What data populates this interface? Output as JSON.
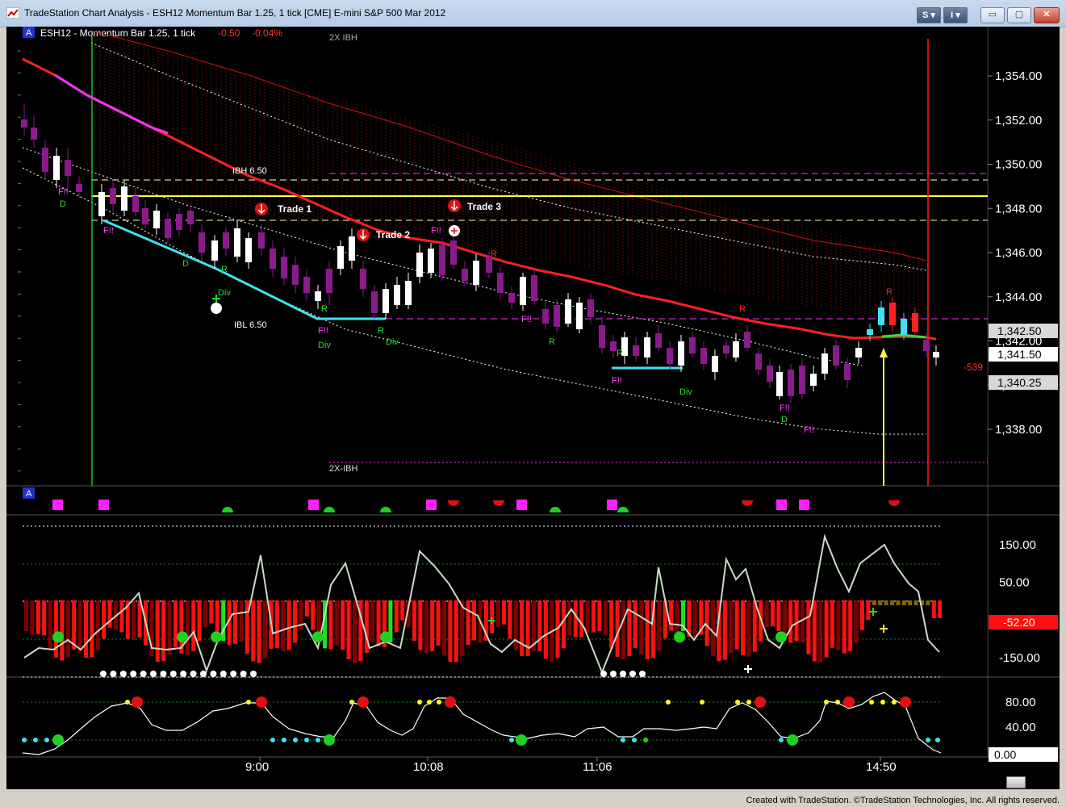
{
  "window": {
    "title": "TradeStation Chart Analysis - ESH12 Momentum Bar 1.25, 1 tick [CME] E-mini S&P 500 Mar 2012",
    "s_button": "S ▾",
    "i_button": "I ▾",
    "minimize": "▭",
    "maximize": "▢",
    "close": "✕"
  },
  "chart": {
    "symbol_label": "ESH12 - Momentum Bar 1.25, 1 tick",
    "change_points": "-0.50",
    "change_percent": "-0.04%",
    "pane_marker": "A",
    "indicator_pane_marker": "A",
    "annotations": {
      "ibh": "IBH  6.50",
      "ibl": "IBL  6.50",
      "two_x_ibh_top": "2X IBH",
      "two_x_ibh_bottom": "2X-IBH",
      "trade1": "Trade 1",
      "trade2": "Trade 2",
      "trade3": "Trade 3",
      "right_value": "-539"
    },
    "signal_labels": {
      "f": "F!!",
      "d": "D",
      "r": "R",
      "div": "Div"
    },
    "price_axis": {
      "ticks": [
        "1,354.00",
        "1,352.00",
        "1,350.00",
        "1,348.00",
        "1,346.00",
        "1,344.00",
        "1,342.00",
        "1,340.00",
        "1,338.00"
      ],
      "tick_values": [
        1354,
        1352,
        1350,
        1348,
        1346,
        1344,
        1342,
        1340,
        1338
      ],
      "last_price_badge": "1,341.50",
      "upper_badge": "1,342.50",
      "lower_badge": "1,340.25"
    },
    "oscillator_axis": {
      "ticks": [
        "150.00",
        "50.00",
        "-150.00"
      ],
      "tick_values": [
        150,
        50,
        -150
      ],
      "current_badge": "-52.20"
    },
    "stoch_axis": {
      "ticks": [
        "80.00",
        "40.00"
      ],
      "tick_values": [
        80,
        40
      ],
      "current_badge": "0.00"
    },
    "time_axis": [
      "9:00",
      "10:08",
      "11:06",
      "14:50"
    ],
    "colors": {
      "background": "#000000",
      "up_bar": "#ffffff",
      "down_bar": "#8b1a8b",
      "ma_red": "#ff2020",
      "ma_magenta": "#ff30ff",
      "cyan": "#40e0f0",
      "yellow": "#ffff40",
      "green": "#20e020",
      "hist_red": "#ff1010",
      "hist_dark": "#800000"
    }
  },
  "footer": {
    "credit": "Created with TradeStation. ©TradeStation Technologies, Inc. All rights reserved."
  }
}
